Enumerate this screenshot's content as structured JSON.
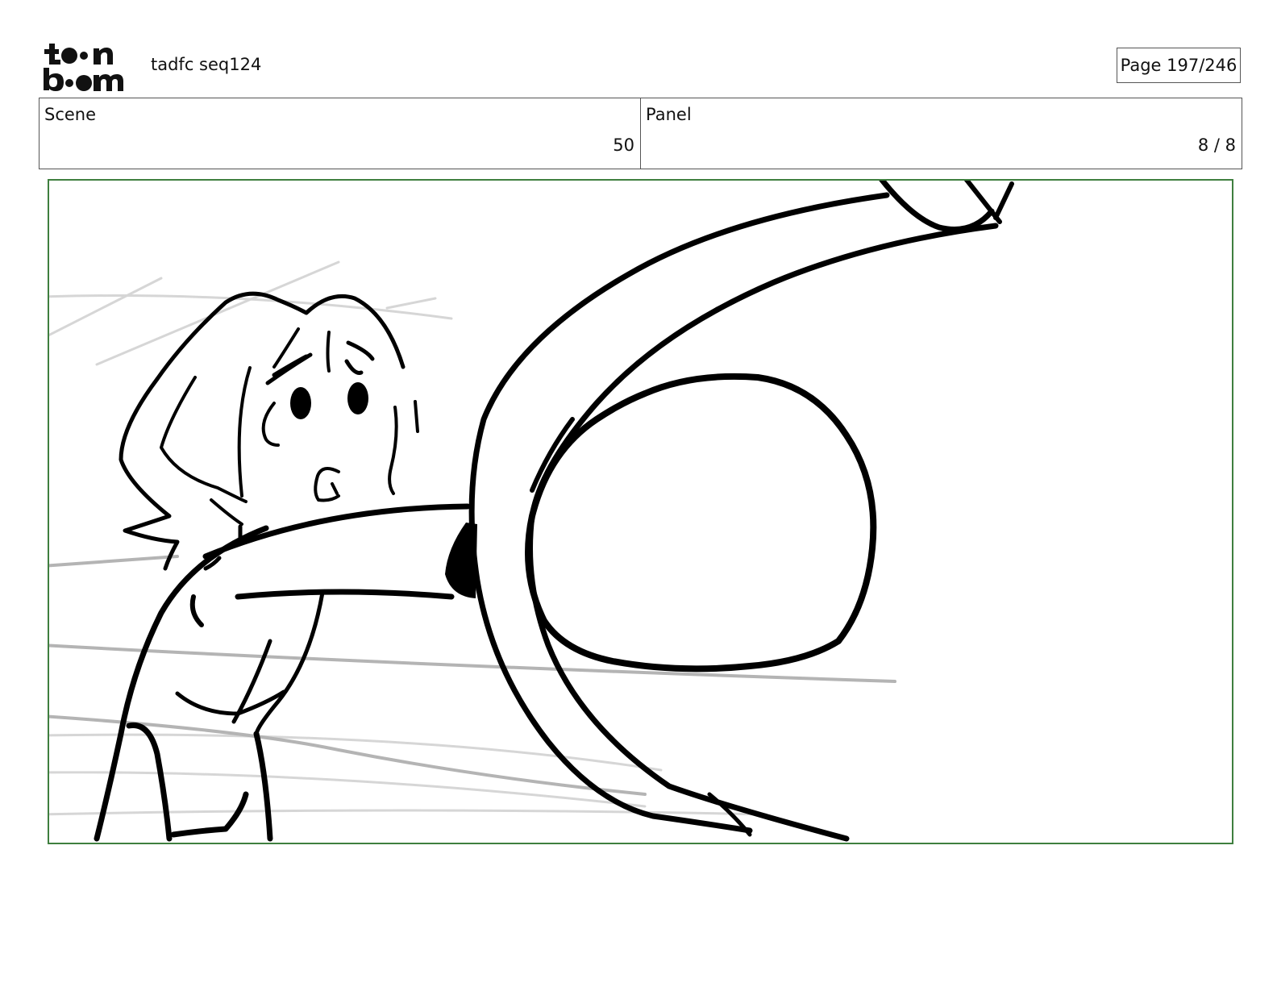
{
  "header": {
    "logo_text": "toon boom",
    "project_title": "tadfc seq124",
    "page_label": "Page 197/246"
  },
  "info": {
    "scene_label": "Scene",
    "scene_value": "50",
    "panel_label": "Panel",
    "panel_value": "8 / 8"
  },
  "colors": {
    "frame_border": "#3f7f3f",
    "ink": "#000000",
    "guide_lines": "#c8c8c8"
  }
}
